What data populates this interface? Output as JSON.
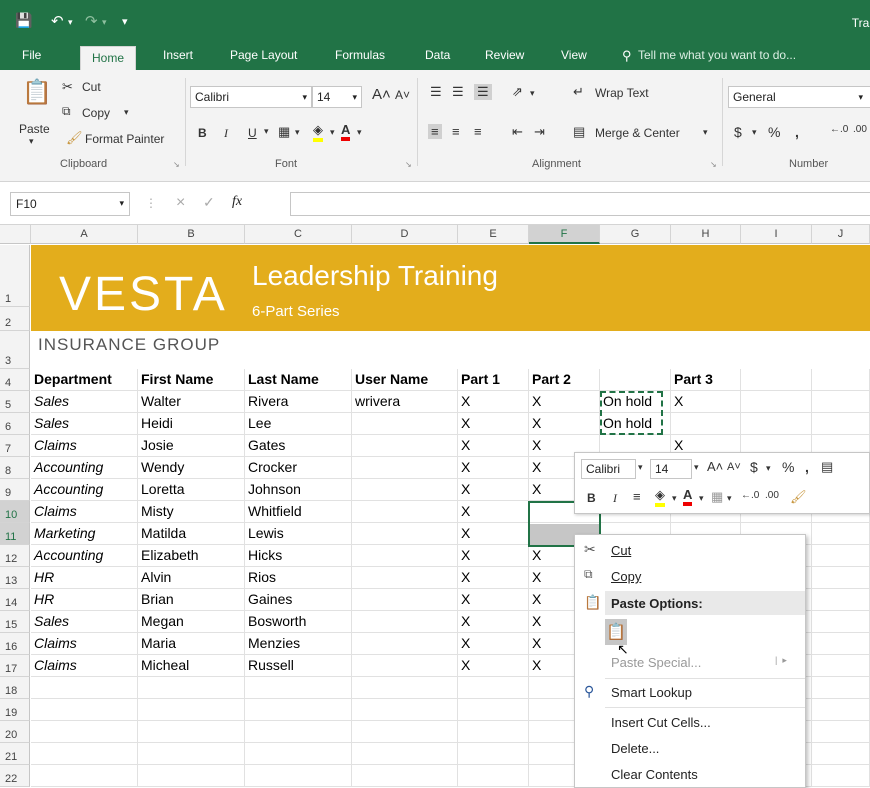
{
  "titlebar": {
    "save_icon": "save-icon",
    "undo_icon": "undo-icon",
    "redo_icon": "redo-icon",
    "customize_icon": "customize-qat-icon",
    "window_title": "Trai"
  },
  "tabs": [
    "File",
    "Home",
    "Insert",
    "Page Layout",
    "Formulas",
    "Data",
    "Review",
    "View"
  ],
  "tell_me": "Tell me what you want to do...",
  "ribbon": {
    "clipboard": {
      "paste": "Paste",
      "cut": "Cut",
      "copy": "Copy",
      "format_painter": "Format Painter",
      "label": "Clipboard"
    },
    "font": {
      "name": "Calibri",
      "size": "14",
      "bold": "B",
      "italic": "I",
      "underline": "U",
      "label": "Font"
    },
    "alignment": {
      "wrap": "Wrap Text",
      "merge": "Merge & Center",
      "label": "Alignment"
    },
    "number": {
      "format": "General",
      "currency": "$",
      "percent": "%",
      "comma": ",",
      "label": "Number"
    }
  },
  "formula_bar": {
    "namebox": "F10",
    "fx": "fx",
    "cancel": "×",
    "enter": "✓",
    "value": ""
  },
  "columns": [
    "A",
    "B",
    "C",
    "D",
    "E",
    "F",
    "G",
    "H",
    "I",
    "J"
  ],
  "rows": [
    "1",
    "2",
    "3",
    "4",
    "5",
    "6",
    "7",
    "8",
    "9",
    "10",
    "11",
    "12",
    "13",
    "14",
    "15",
    "16",
    "17",
    "18",
    "19",
    "20",
    "21",
    "22"
  ],
  "banner": {
    "logo": "VESTA",
    "title": "Leadership Training",
    "subtitle": "6-Part Series",
    "company": "INSURANCE GROUP"
  },
  "headers": [
    "Department",
    "First Name",
    "Last Name",
    "User Name",
    "Part 1",
    "Part 2",
    "",
    "Part 3"
  ],
  "data": [
    [
      "Sales",
      "Walter",
      "Rivera",
      "wrivera",
      "X",
      "X",
      "On hold",
      "X"
    ],
    [
      "Sales",
      "Heidi",
      "Lee",
      "",
      "X",
      "X",
      "On hold",
      ""
    ],
    [
      "Claims",
      "Josie",
      "Gates",
      "",
      "X",
      "X",
      "",
      "X"
    ],
    [
      "Accounting",
      "Wendy",
      "Crocker",
      "",
      "X",
      "X",
      "",
      ""
    ],
    [
      "Accounting",
      "Loretta",
      "Johnson",
      "",
      "X",
      "X",
      "",
      ""
    ],
    [
      "Claims",
      "Misty",
      "Whitfield",
      "",
      "X",
      "",
      "",
      ""
    ],
    [
      "Marketing",
      "Matilda",
      "Lewis",
      "",
      "X",
      "",
      "",
      ""
    ],
    [
      "Accounting",
      "Elizabeth",
      "Hicks",
      "",
      "X",
      "X",
      "",
      ""
    ],
    [
      "HR",
      "Alvin",
      "Rios",
      "",
      "X",
      "X",
      "",
      ""
    ],
    [
      "HR",
      "Brian",
      "Gaines",
      "",
      "X",
      "X",
      "",
      ""
    ],
    [
      "Sales",
      "Megan",
      "Bosworth",
      "",
      "X",
      "X",
      "",
      ""
    ],
    [
      "Claims",
      "Maria",
      "Menzies",
      "",
      "X",
      "X",
      "",
      ""
    ],
    [
      "Claims",
      "Micheal",
      "Russell",
      "",
      "X",
      "X",
      "",
      ""
    ]
  ],
  "minitoolbar": {
    "font": "Calibri",
    "size": "14",
    "currency": "$",
    "percent": "%",
    "comma": ",",
    "bold": "B",
    "italic": "I"
  },
  "context_menu": {
    "cut": "Cut",
    "copy": "Copy",
    "paste_options": "Paste Options:",
    "paste_special": "Paste Special...",
    "smart_lookup": "Smart Lookup",
    "insert_cut_cells": "Insert Cut Cells...",
    "delete": "Delete...",
    "clear_contents": "Clear Contents"
  },
  "colors": {
    "excel_green": "#217346",
    "banner_gold": "#e3ad1c",
    "copy_marquee": "#217346"
  }
}
